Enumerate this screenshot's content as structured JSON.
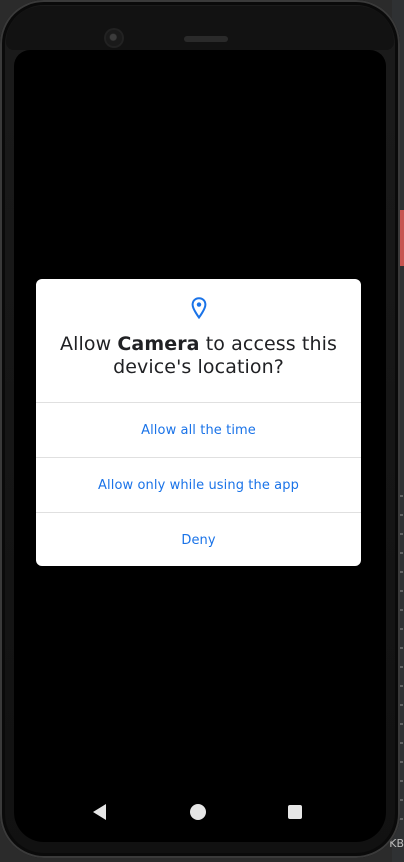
{
  "permission_dialog": {
    "title_prefix": "Allow ",
    "app_name": "Camera",
    "title_suffix": " to access this device's location?",
    "icon": "location-pin-icon",
    "options": [
      "Allow all the time",
      "Allow only while using the app",
      "Deny"
    ]
  },
  "navigation_bar": {
    "back_icon": "back-icon",
    "home_icon": "home-icon",
    "recents_icon": "recents-icon"
  },
  "side_panel": {
    "bottom_label": "KB"
  },
  "colors": {
    "accent": "#1a73e8",
    "screen_background": "#000000",
    "dialog_background": "#ffffff",
    "title_text": "#202124"
  }
}
